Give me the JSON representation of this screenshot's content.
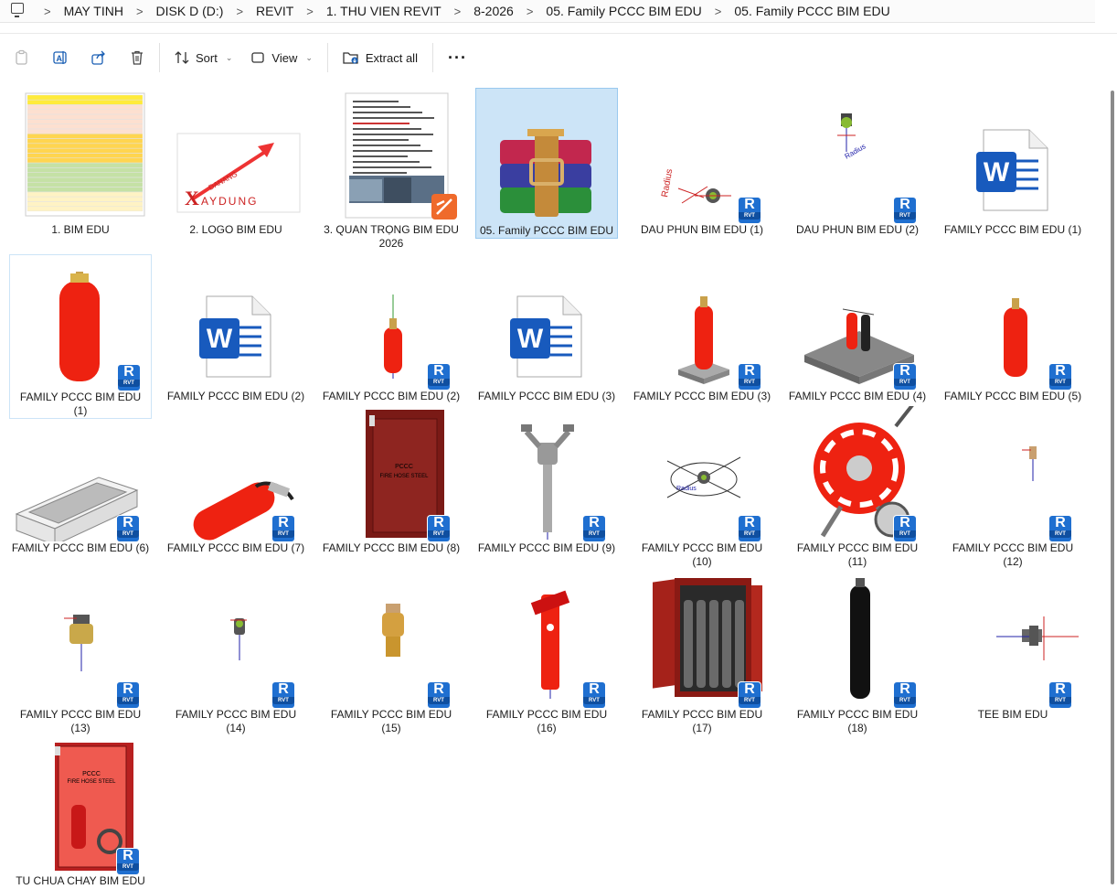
{
  "breadcrumb": [
    "MAY TINH",
    "DISK D (D:)",
    "REVIT",
    "1. THU VIEN REVIT",
    "8-2026",
    "05. Family PCCC BIM EDU",
    "05. Family PCCC BIM EDU"
  ],
  "toolbar": {
    "sort": "Sort",
    "view": "View",
    "extract": "Extract all",
    "more": "···"
  },
  "rvt_badge": {
    "text": "R",
    "sub": "RVT"
  },
  "files": [
    {
      "name": "1. BIM EDU",
      "kind": "sheet"
    },
    {
      "name": "2. LOGO BIM EDU",
      "kind": "logo",
      "logo_text": "XAYDUNG",
      "logo_small": "DANANG"
    },
    {
      "name": "3. QUAN TRỌNG BIM EDU 2026",
      "kind": "pdf"
    },
    {
      "name": "05. Family PCCC BIM EDU",
      "kind": "rar"
    },
    {
      "name": "DAU PHUN BIM EDU (1)",
      "kind": "sprinkler1"
    },
    {
      "name": "DAU PHUN BIM EDU (2)",
      "kind": "sprinkler2"
    },
    {
      "name": "FAMILY PCCC BIM EDU (1)",
      "kind": "word"
    },
    {
      "name": "FAMILY PCCC BIM EDU (1)",
      "kind": "cylinder"
    },
    {
      "name": "FAMILY PCCC BIM EDU (2)",
      "kind": "word"
    },
    {
      "name": "FAMILY PCCC BIM EDU (2)",
      "kind": "smallcyl"
    },
    {
      "name": "FAMILY PCCC BIM EDU (3)",
      "kind": "word"
    },
    {
      "name": "FAMILY PCCC BIM EDU (3)",
      "kind": "cylbase"
    },
    {
      "name": "FAMILY PCCC BIM EDU (4)",
      "kind": "platform"
    },
    {
      "name": "FAMILY PCCC BIM EDU (5)",
      "kind": "cylinder2"
    },
    {
      "name": "FAMILY PCCC BIM EDU (6)",
      "kind": "tray"
    },
    {
      "name": "FAMILY PCCC BIM EDU (7)",
      "kind": "extinguisher"
    },
    {
      "name": "FAMILY PCCC BIM EDU (8)",
      "kind": "cabinet",
      "cabinet_text": "PCCC",
      "cabinet_sub": "FIRE HOSE STEEL"
    },
    {
      "name": "FAMILY PCCC BIM EDU (9)",
      "kind": "hydrant"
    },
    {
      "name": "FAMILY PCCC BIM EDU (10)",
      "kind": "sprinkler3"
    },
    {
      "name": "FAMILY PCCC BIM EDU (11)",
      "kind": "reel"
    },
    {
      "name": "FAMILY PCCC BIM EDU (12)",
      "kind": "tinyvalve"
    },
    {
      "name": "FAMILY PCCC BIM EDU (13)",
      "kind": "valve"
    },
    {
      "name": "FAMILY PCCC BIM EDU (14)",
      "kind": "valve2"
    },
    {
      "name": "FAMILY PCCC BIM EDU (15)",
      "kind": "valve3"
    },
    {
      "name": "FAMILY PCCC BIM EDU (16)",
      "kind": "redhydrant"
    },
    {
      "name": "FAMILY PCCC BIM EDU (17)",
      "kind": "rack"
    },
    {
      "name": "FAMILY PCCC BIM EDU (18)",
      "kind": "blackcyl"
    },
    {
      "name": "TEE BIM EDU",
      "kind": "tee"
    },
    {
      "name": "TU CHUA CHAY BIM EDU",
      "kind": "redcabinet",
      "cabinet_text": "PCCC",
      "cabinet_sub": "FIRE HOSE STEEL"
    }
  ],
  "selected_index": 3,
  "focused_index": 7
}
